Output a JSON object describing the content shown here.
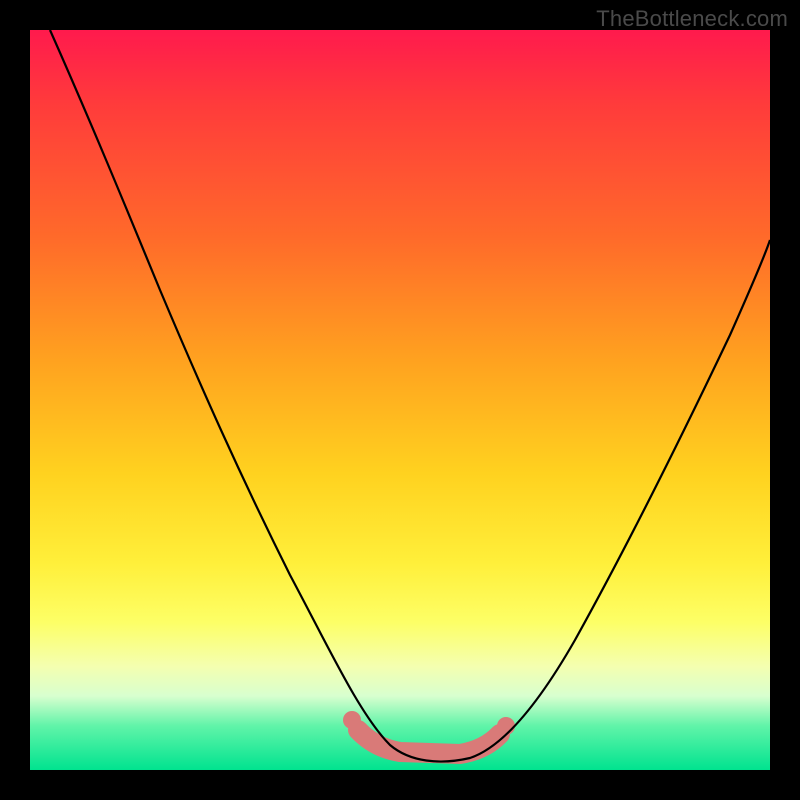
{
  "watermark": "TheBottleneck.com",
  "chart_data": {
    "type": "line",
    "title": "",
    "xlabel": "",
    "ylabel": "",
    "xlim": [
      0,
      100
    ],
    "ylim": [
      0,
      100
    ],
    "grid": false,
    "series": [
      {
        "name": "curve",
        "x": [
          3,
          8,
          14,
          20,
          26,
          32,
          38,
          43,
          47,
          50,
          54,
          58,
          62,
          70,
          80,
          90,
          100
        ],
        "y": [
          100,
          85,
          70,
          56,
          43,
          31,
          20,
          11,
          5,
          2,
          1,
          1,
          2,
          8,
          22,
          40,
          60
        ]
      }
    ],
    "highlight_segment": {
      "name": "bottom-pink-band",
      "x": [
        45,
        50,
        55,
        60,
        63
      ],
      "y": [
        3,
        1.5,
        1,
        1.2,
        2.5
      ]
    },
    "colors": {
      "gradient_top": "#ff1a4d",
      "gradient_mid": "#ffd21f",
      "gradient_bottom": "#00e38f",
      "curve": "#000000",
      "highlight": "#d97a78",
      "frame": "#000000"
    }
  }
}
